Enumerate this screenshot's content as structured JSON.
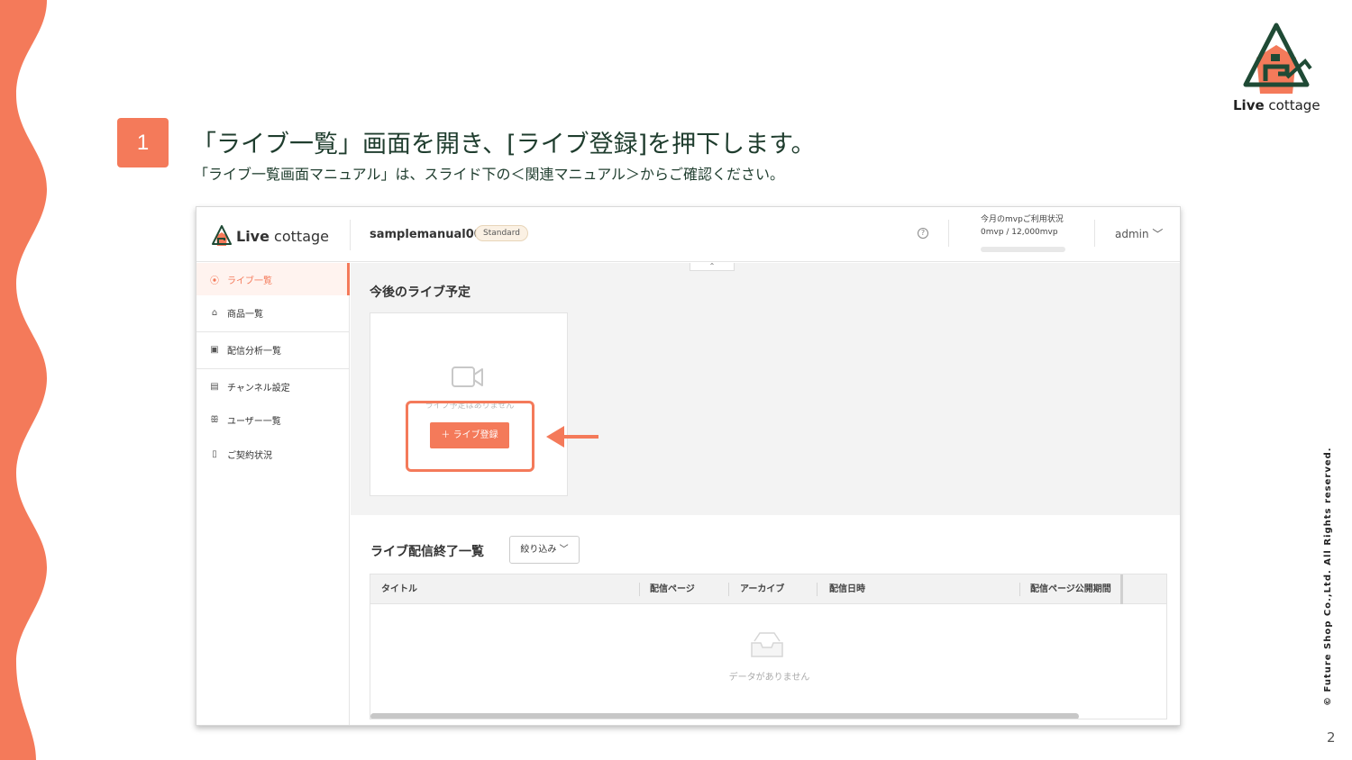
{
  "slide": {
    "step_number": "1",
    "headline": "「ライブ一覧」画面を開き、[ライブ登録]を押下します。",
    "subline": "「ライブ一覧画面マニュアル」は、スライド下の＜関連マニュアル＞からご確認ください。",
    "brand_name_bold": "Live",
    "brand_name_rest": " cottage",
    "copyright": "© Future Shop Co.,Ltd. All Rights reserved.",
    "page_number": "2",
    "accent_color": "#f47a5a"
  },
  "app": {
    "logo_bold": "Live",
    "logo_rest": " cottage",
    "account_name": "samplemanual001",
    "plan_badge": "Standard",
    "help_icon": "?",
    "usage_label": "今月のmvpご利用状況",
    "usage_value": "0mvp / 12,000mvp",
    "usage_fraction": 0.0,
    "user_menu": "admin ﹀"
  },
  "sidebar": {
    "items": [
      {
        "label": "ライブ一覧",
        "icon": "broadcast-icon",
        "glyph": "⦿"
      },
      {
        "label": "商品一覧",
        "icon": "bag-icon",
        "glyph": "⌂"
      },
      {
        "label": "配信分析一覧",
        "icon": "chart-icon",
        "glyph": "▣"
      },
      {
        "label": "チャンネル設定",
        "icon": "building-icon",
        "glyph": "▤"
      },
      {
        "label": "ユーザー一覧",
        "icon": "users-icon",
        "glyph": "ꕥ"
      },
      {
        "label": "ご契約状況",
        "icon": "document-icon",
        "glyph": "▯"
      }
    ]
  },
  "main": {
    "collapse_glyph": "⌃",
    "upcoming_title": "今後のライブ予定",
    "empty_text": "ライブ予定はありません",
    "register_button": "＋  ライブ登録",
    "ended_title": "ライブ配信終了一覧",
    "filter_button": "絞り込み  ﹀",
    "table_headers": [
      "タイトル",
      "配信ページ",
      "アーカイブ",
      "配信日時",
      "配信ページ公開期間"
    ],
    "no_data": "データがありません"
  }
}
